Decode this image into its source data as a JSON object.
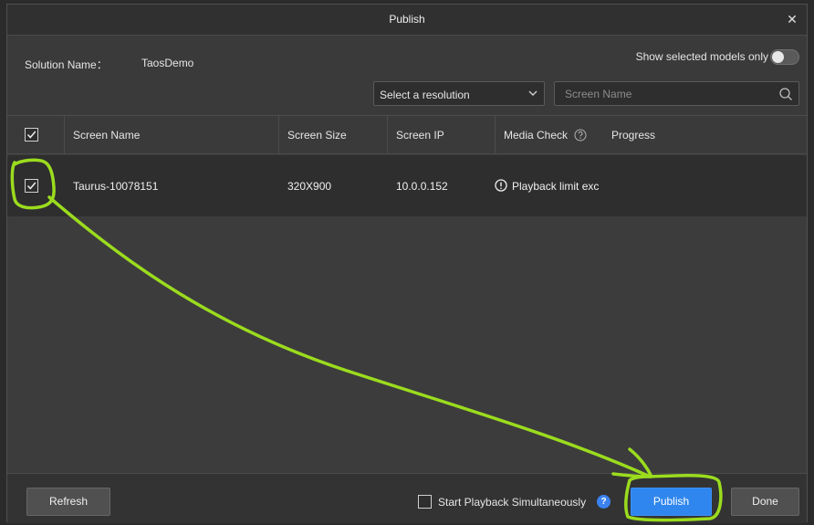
{
  "window": {
    "title": "Publish"
  },
  "solution": {
    "label": "Solution Name：",
    "value": "TaosDemo"
  },
  "filters": {
    "show_selected_label": "Show selected models only",
    "show_selected_on": false,
    "resolution_value": "Select a resolution",
    "search_placeholder": "Screen Name"
  },
  "table": {
    "columns": [
      "Screen Name",
      "Screen Size",
      "Screen IP",
      "Media Check",
      "Progress"
    ],
    "select_all_checked": true,
    "rows": [
      {
        "checked": true,
        "screen_name": "Taurus-10078151",
        "screen_size": "320X900",
        "screen_ip": "10.0.0.152",
        "media_check": "Playback limit exc",
        "progress": ""
      }
    ]
  },
  "footer": {
    "refresh_label": "Refresh",
    "start_simultaneously_label": "Start Playback Simultaneously",
    "start_simultaneously_checked": false,
    "publish_label": "Publish",
    "done_label": "Done"
  },
  "colors": {
    "accent": "#2f86ee",
    "annotation": "#9bdc1e"
  },
  "icons": {
    "close": "close-icon",
    "dropdown": "chevron-down-icon",
    "search": "search-icon",
    "help": "question-circle-icon",
    "warning": "exclamation-circle-icon",
    "check": "checkmark-icon"
  }
}
